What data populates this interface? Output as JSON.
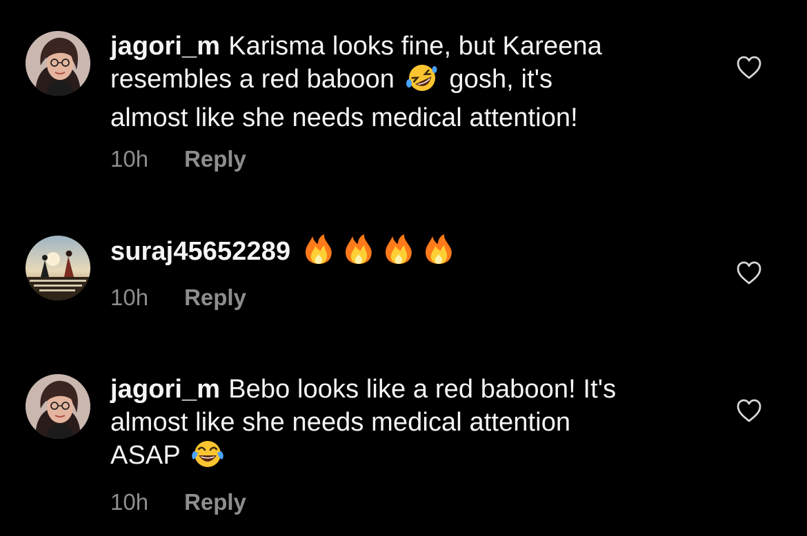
{
  "comments": [
    {
      "username": "jagori_m",
      "text_1": "Karisma looks fine, but Kareena",
      "text_2": "resembles a red baboon",
      "emoji_1": "rolling-on-floor-laughing",
      "text_3": "gosh, it's",
      "text_4": "almost like she needs medical attention!",
      "time": "10h",
      "reply_label": "Reply",
      "avatar_icon": "profile-photo-woman"
    },
    {
      "username": "suraj45652289",
      "emoji_count": 4,
      "emoji": "fire",
      "time": "10h",
      "reply_label": "Reply",
      "avatar_icon": "profile-photo-landscape"
    },
    {
      "username": "jagori_m",
      "text_1": "Bebo looks like a red baboon! It's",
      "text_2": "almost like she needs medical attention",
      "text_3": "ASAP",
      "emoji_1": "face-with-tears-of-joy",
      "time": "10h",
      "reply_label": "Reply",
      "avatar_icon": "profile-photo-woman"
    }
  ],
  "colors": {
    "background": "#000000",
    "text": "#f5f5f5",
    "secondary": "#8e8e8e"
  }
}
